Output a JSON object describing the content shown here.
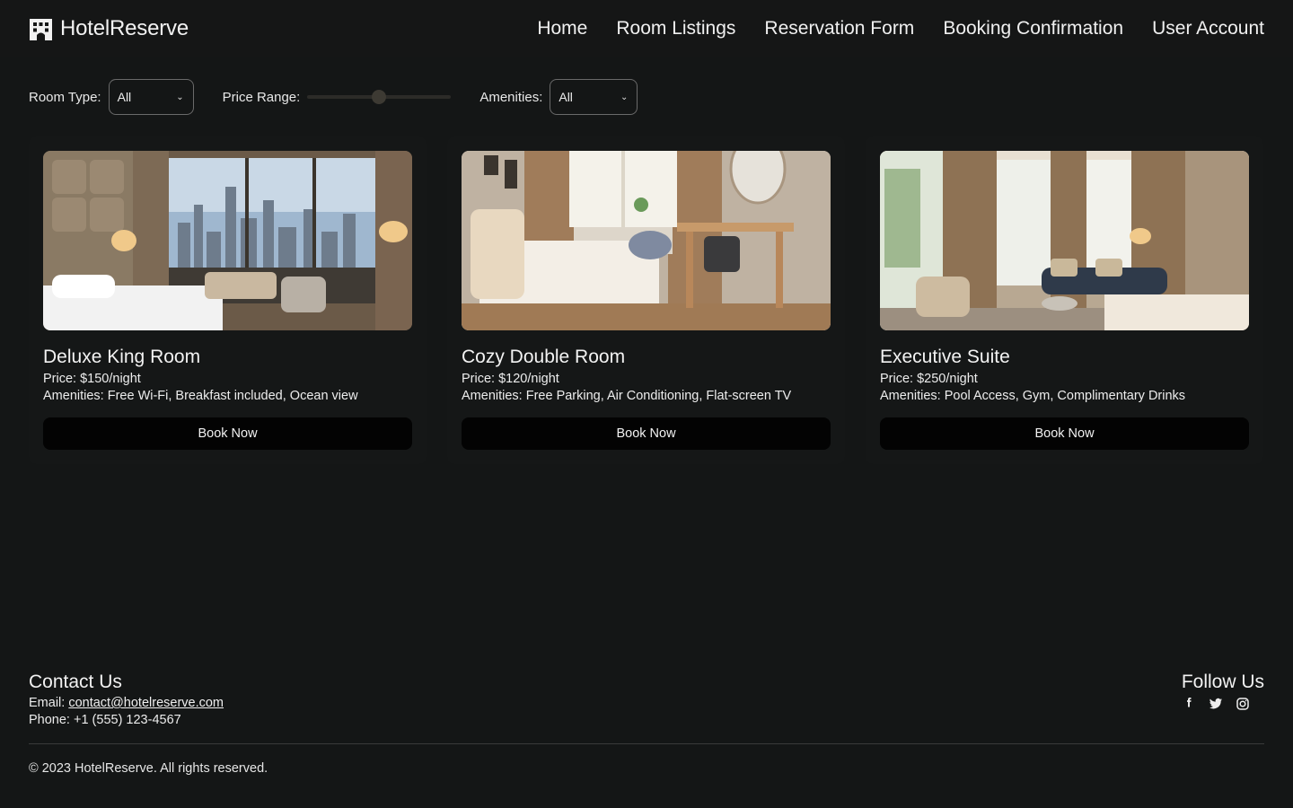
{
  "app": {
    "brand": "HotelReserve",
    "icon": "hotel-building-icon"
  },
  "nav": {
    "items": [
      {
        "label": "Home"
      },
      {
        "label": "Room Listings"
      },
      {
        "label": "Reservation Form"
      },
      {
        "label": "Booking Confirmation"
      },
      {
        "label": "User Account"
      }
    ]
  },
  "filters": {
    "room_type_label": "Room Type:",
    "room_type_value": "All",
    "price_range_label": "Price Range:",
    "price_range_level": 0.5,
    "amenities_label": "Amenities:",
    "amenities_value": "All"
  },
  "rooms": [
    {
      "title": "Deluxe King Room",
      "price": "Price: $150/night",
      "amenities": "Amenities: Free Wi-Fi, Breakfast included, Ocean view",
      "button": "Book Now",
      "image": "deluxe-king-room-photo"
    },
    {
      "title": "Cozy Double Room",
      "price": "Price: $120/night",
      "amenities": "Amenities: Free Parking, Air Conditioning, Flat-screen TV",
      "button": "Book Now",
      "image": "cozy-double-room-photo"
    },
    {
      "title": "Executive Suite",
      "price": "Price: $250/night",
      "amenities": "Amenities: Pool Access, Gym, Complimentary Drinks",
      "button": "Book Now",
      "image": "executive-suite-photo"
    }
  ],
  "footer": {
    "contact_heading": "Contact Us",
    "email_label": "Email:",
    "email": "contact@hotelreserve.com",
    "phone": "Phone: +1 (555) 123-4567",
    "follow_heading": "Follow Us",
    "socials": [
      "facebook-icon",
      "twitter-icon",
      "instagram-icon"
    ],
    "copyright": "© 2023 HotelReserve. All rights reserved."
  },
  "colors": {
    "background": "#141616",
    "button": "#030303",
    "text": "#ececec"
  }
}
